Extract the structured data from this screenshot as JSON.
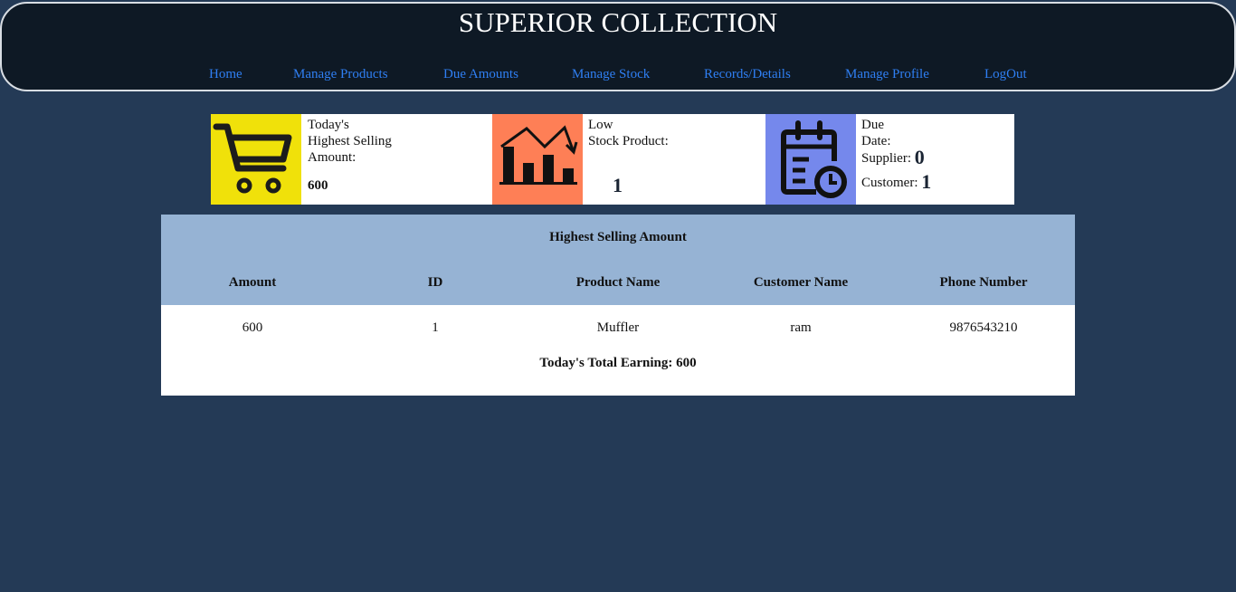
{
  "header": {
    "title": "SUPERIOR COLLECTION",
    "nav": [
      "Home",
      "Manage Products",
      "Due Amounts",
      "Manage Stock",
      "Records/Details",
      "Manage Profile",
      "LogOut"
    ]
  },
  "cards": {
    "highest_selling": {
      "line1": "Today's",
      "line2": "Highest Selling",
      "line3": "Amount:",
      "value": "600",
      "icon": "shopping-cart-icon",
      "color": "#f0e10a"
    },
    "low_stock": {
      "line1": "Low",
      "line2": "Stock Product:",
      "value": "1",
      "icon": "declining-bar-chart-icon",
      "color": "#fe7f56"
    },
    "due_date": {
      "line1": "Due",
      "line2": "Date:",
      "supplier_label": "Supplier:",
      "supplier_value": "0",
      "customer_label": "Customer:",
      "customer_value": "1",
      "icon": "calendar-clock-icon",
      "color": "#7588ec"
    }
  },
  "table": {
    "title": "Highest Selling Amount",
    "columns": [
      "Amount",
      "ID",
      "Product Name",
      "Customer Name",
      "Phone Number"
    ],
    "rows": [
      [
        "600",
        "1",
        "Muffler",
        "ram",
        "9876543210"
      ]
    ],
    "total": "Today's Total Earning: 600"
  },
  "colors": {
    "page_bg": "#243a56",
    "header_bg": "#0e1925",
    "nav_link": "#2f7ff3",
    "table_head_bg": "#96b3d4"
  }
}
